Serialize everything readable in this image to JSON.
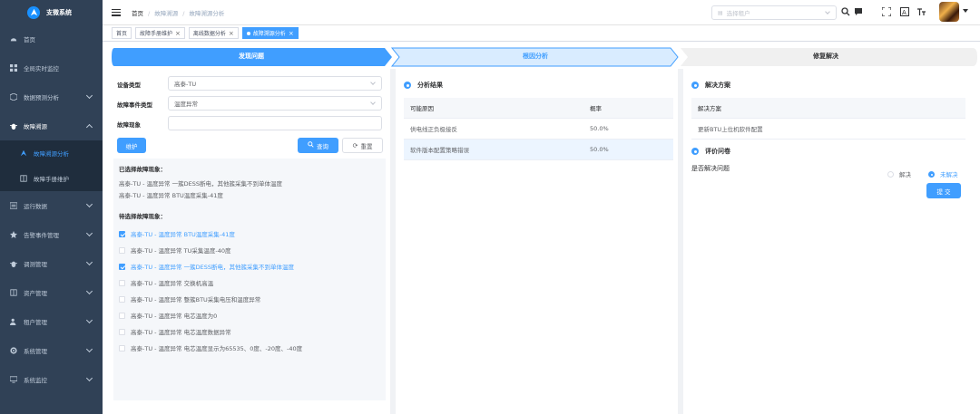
{
  "app": {
    "title": "支微系统"
  },
  "sidebar": {
    "items": [
      {
        "label": "首页",
        "icon": "dashboard-icon"
      },
      {
        "label": "全局实时监控",
        "icon": "grid-icon"
      },
      {
        "label": "数据预测分析",
        "icon": "cube-icon"
      },
      {
        "label": "故障溯源",
        "icon": "bug-icon",
        "sub": [
          {
            "label": "故障溯源分析",
            "icon": "guide-icon"
          },
          {
            "label": "故障手册维护",
            "icon": "book-icon"
          }
        ]
      },
      {
        "label": "运行数据",
        "icon": "log-icon"
      },
      {
        "label": "告警事件管理",
        "icon": "star-icon"
      },
      {
        "label": "调测管理",
        "icon": "bug-icon"
      },
      {
        "label": "资产管理",
        "icon": "book-icon"
      },
      {
        "label": "租户管理",
        "icon": "peoples-icon"
      },
      {
        "label": "系统管理",
        "icon": "system-icon"
      },
      {
        "label": "系统监控",
        "icon": "monitor-icon"
      }
    ]
  },
  "navbar": {
    "breadcrumb": [
      "首页",
      "故障溯源",
      "故障溯源分析"
    ],
    "tenant_placeholder": "选择租户"
  },
  "tags": [
    {
      "label": "首页",
      "closable": false,
      "active": false
    },
    {
      "label": "故障手册维护",
      "closable": true,
      "active": false
    },
    {
      "label": "离线数据分析",
      "closable": true,
      "active": false
    },
    {
      "label": "故障溯源分析",
      "closable": true,
      "active": true
    }
  ],
  "steps": [
    "发现问题",
    "根因分析",
    "修复解决"
  ],
  "form": {
    "device_type_label": "设备类型",
    "device_type_value": "高泰-TU",
    "event_type_label": "故障事件类型",
    "event_type_value": "温度异常",
    "phenomenon_label": "故障现象",
    "phenomenon_value": "",
    "maintain_btn": "维护",
    "query_btn": "查询",
    "reset_btn": "重置"
  },
  "selected": {
    "title": "已选择故障现象：",
    "items": [
      "高泰-TU - 温度异常 一簇DESS断电，其他簇采集不到单体温度",
      "高泰-TU - 温度异常 BTU温度采集-41度"
    ]
  },
  "pending": {
    "title": "待选择故障现象：",
    "items": [
      {
        "label": "高泰-TU - 温度异常 BTU温度采集-41度",
        "checked": true
      },
      {
        "label": "高泰-TU - 温度异常 TU采集温度-40度",
        "checked": false
      },
      {
        "label": "高泰-TU - 温度异常 一簇DESS断电，其他簇采集不到单体温度",
        "checked": true
      },
      {
        "label": "高泰-TU - 温度异常 交换机高温",
        "checked": false
      },
      {
        "label": "高泰-TU - 温度异常 整簇BTU采集电压和温度异常",
        "checked": false
      },
      {
        "label": "高泰-TU - 温度异常 电芯温度为0",
        "checked": false
      },
      {
        "label": "高泰-TU - 温度异常 电芯温度数据异常",
        "checked": false
      },
      {
        "label": "高泰-TU - 温度异常 电芯温度显示为65535、0度、-20度、-40度",
        "checked": false
      }
    ]
  },
  "analysis": {
    "title": "分析结果",
    "headers": [
      "可能原因",
      "概率"
    ],
    "rows": [
      {
        "cause": "供电线正负极接反",
        "prob": "50.0%"
      },
      {
        "cause": "软件版本配置策略错误",
        "prob": "50.0%"
      }
    ]
  },
  "solution": {
    "title": "解决方案",
    "header": "解决方案",
    "rows": [
      "更新BTU上位机软件配置"
    ]
  },
  "survey": {
    "title": "评价问卷",
    "question": "是否解决问题",
    "options": [
      "解决",
      "未解决"
    ],
    "selected": "未解决",
    "submit": "提 交"
  },
  "colors": {
    "primary": "#409eff",
    "sidebar_bg": "#304156",
    "sidebar_text": "#bfcbd9"
  }
}
